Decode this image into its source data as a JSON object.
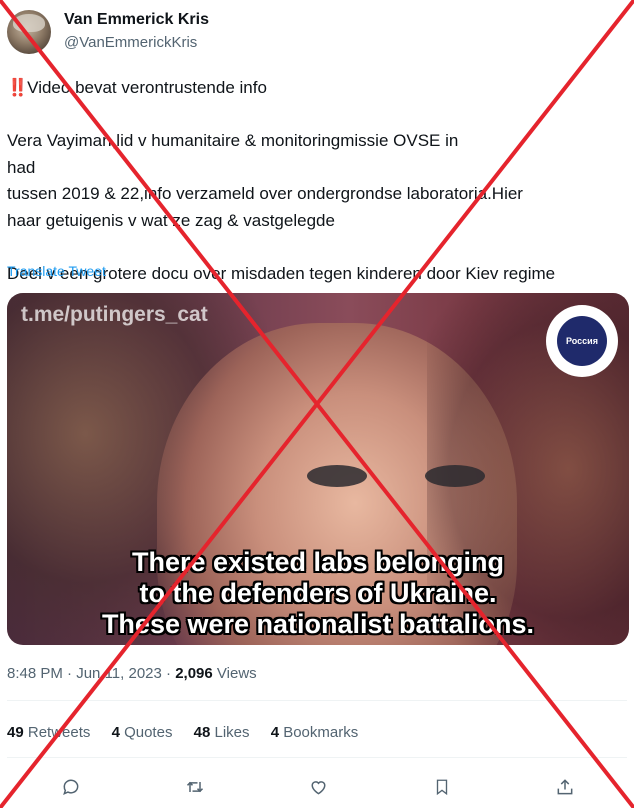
{
  "author": {
    "display_name": "Van Emmerick Kris",
    "handle": "@VanEmmerickKris"
  },
  "tweet": {
    "warning_icon": "‼️",
    "line1": "Video bevat verontrustende info",
    "line2a": "Vera Vayiman,lid v humanitaire & monitoringmissie OVSE in",
    "flag_icon": "ukraine-flag",
    "line2b": "had",
    "line3": "tussen 2019 & 22,info verzameld over ondergrondse laboratoria.Hier",
    "line4": "haar getuigenis v wat ze zag & vastgelegde",
    "line5": "Deel v een grotere docu over misdaden tegen kinderen door Kiev regime",
    "translate_label": "Translate Tweet"
  },
  "media": {
    "watermark": "t.me/putingers_cat",
    "badge_text": "Россия",
    "subtitle_1": "There existed labs belonging",
    "subtitle_2": "to the defenders of Ukraine.",
    "subtitle_3": "These were nationalist battalions."
  },
  "meta": {
    "time": "8:48 PM",
    "separator": "·",
    "date": "Jun 11, 2023",
    "separator2": "·",
    "views_count": "2,096",
    "views_label": "Views"
  },
  "stats": {
    "retweets_count": "49",
    "retweets_label": "Retweets",
    "quotes_count": "4",
    "quotes_label": "Quotes",
    "likes_count": "48",
    "likes_label": "Likes",
    "bookmarks_count": "4",
    "bookmarks_label": "Bookmarks"
  },
  "actions": [
    "reply-icon",
    "retweet-icon",
    "like-icon",
    "bookmark-icon",
    "share-icon"
  ],
  "colors": {
    "link": "#1d9bf0",
    "muted": "#536471",
    "cross": "#e5242d"
  }
}
